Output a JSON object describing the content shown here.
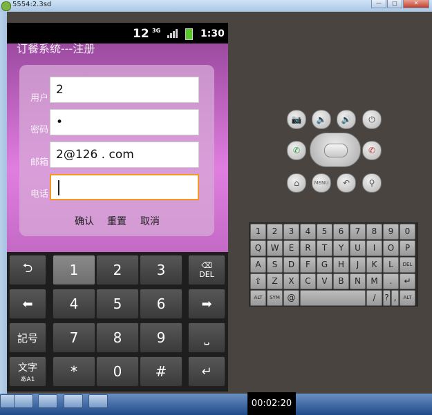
{
  "window": {
    "title": "5554:2.3sd",
    "btn_min": "—",
    "btn_max": "□",
    "btn_close": "✕"
  },
  "status": {
    "network_12": "12",
    "network_3g": "3G",
    "time": "1:30"
  },
  "app": {
    "title": "订餐系统---注册",
    "labels": {
      "user": "用户",
      "password": "密码",
      "email": "邮箱",
      "phone": "电话"
    },
    "fields": {
      "user": "2",
      "password": "•",
      "email": "2@126 . com",
      "phone": ""
    },
    "buttons": {
      "confirm": "确认",
      "reset": "重置",
      "cancel": "取消"
    }
  },
  "keyboard": {
    "back": "⮌",
    "del": "⌫\nDEL",
    "left": "⬅",
    "right": "➡",
    "symbol": "記号",
    "space": "⎵",
    "lang": "文字",
    "lang_sub": "あA1",
    "enter": "↵",
    "digits": [
      "1",
      "2",
      "3",
      "4",
      "5",
      "6",
      "7",
      "8",
      "9",
      "*",
      "0",
      "#"
    ]
  },
  "qwerty": {
    "row1": [
      "1",
      "2",
      "3",
      "4",
      "5",
      "6",
      "7",
      "8",
      "9",
      "0"
    ],
    "row2": [
      "Q",
      "W",
      "E",
      "R",
      "T",
      "Y",
      "U",
      "I",
      "O",
      "P"
    ],
    "row3": [
      "A",
      "S",
      "D",
      "F",
      "G",
      "H",
      "J",
      "K",
      "L",
      "DEL"
    ],
    "row4": [
      "⇧",
      "Z",
      "X",
      "C",
      "V",
      "B",
      "N",
      "M",
      ".",
      "↵"
    ],
    "row5": [
      "ALT",
      "SYM",
      "@",
      "",
      "/",
      "?",
      ",",
      "ALT"
    ]
  },
  "hw": {
    "camera": "📷",
    "vol_down": "🔉",
    "vol_up": "🔊",
    "power": "⏻",
    "call": "✆",
    "end": "✆",
    "home": "⌂",
    "menu": "MENU",
    "back": "↶",
    "search": "⚲"
  },
  "taskbar": {
    "timer": "00:02:20"
  }
}
